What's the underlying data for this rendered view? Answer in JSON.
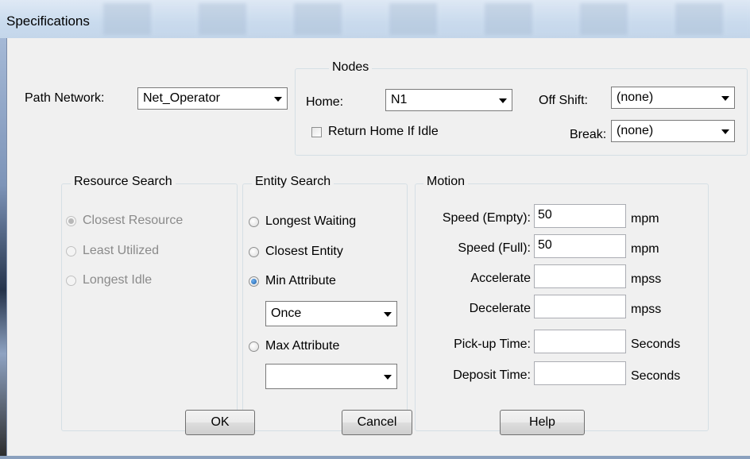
{
  "window": {
    "title": "Specifications"
  },
  "path_network": {
    "label": "Path Network:",
    "value": "Net_Operator"
  },
  "nodes": {
    "legend": "Nodes",
    "home_label": "Home:",
    "home_value": "N1",
    "return_home_label": "Return Home If Idle",
    "return_home_checked": false,
    "off_shift_label": "Off Shift:",
    "off_shift_value": "(none)",
    "break_label": "Break:",
    "break_value": "(none)"
  },
  "resource_search": {
    "legend": "Resource Search",
    "options": [
      "Closest Resource",
      "Least Utilized",
      "Longest Idle"
    ],
    "selected": "Closest Resource",
    "enabled": false
  },
  "entity_search": {
    "legend": "Entity Search",
    "options": [
      "Longest Waiting",
      "Closest Entity",
      "Min Attribute",
      "Max Attribute"
    ],
    "selected": "Min Attribute",
    "min_attribute_value": "Once",
    "max_attribute_value": ""
  },
  "motion": {
    "legend": "Motion",
    "rows": [
      {
        "label": "Speed (Empty):",
        "value": "50",
        "unit": "mpm"
      },
      {
        "label": "Speed (Full):",
        "value": "50",
        "unit": "mpm"
      },
      {
        "label": "Accelerate",
        "value": "",
        "unit": "mpss"
      },
      {
        "label": "Decelerate",
        "value": "",
        "unit": "mpss"
      },
      {
        "label": "Pick-up Time:",
        "value": "",
        "unit": "Seconds"
      },
      {
        "label": "Deposit Time:",
        "value": "",
        "unit": "Seconds"
      }
    ]
  },
  "buttons": {
    "ok": "OK",
    "cancel": "Cancel",
    "help": "Help"
  }
}
